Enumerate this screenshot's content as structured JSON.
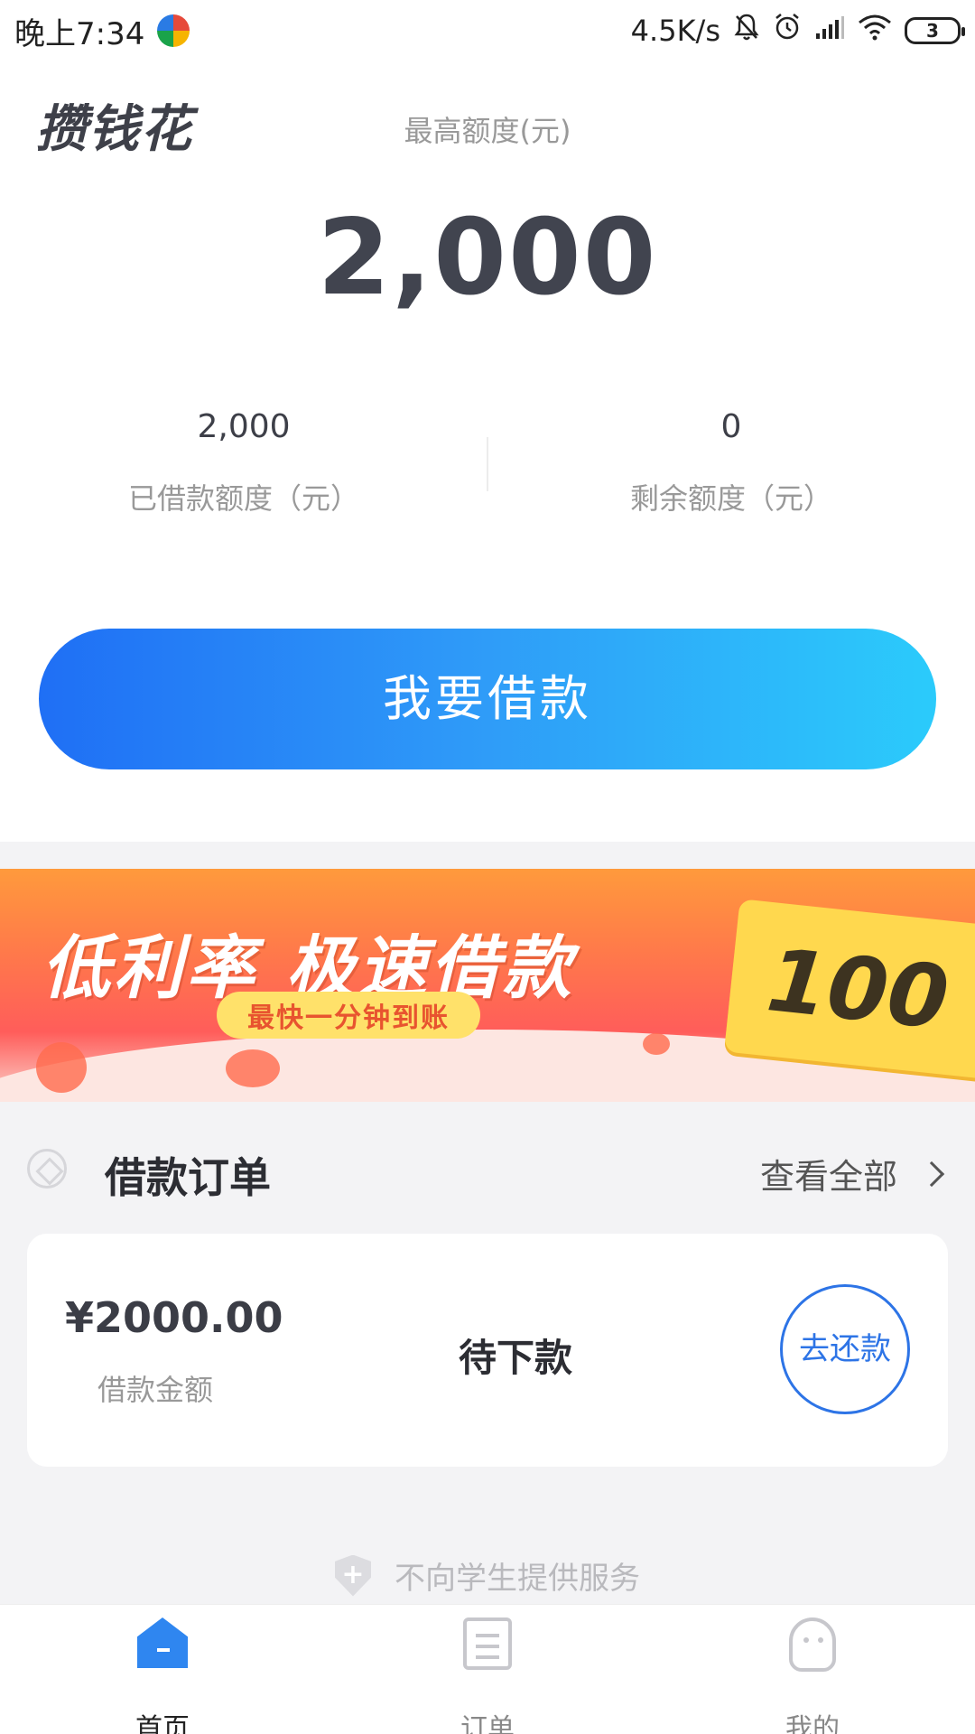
{
  "status_bar": {
    "time": "晚上7:34",
    "net_speed": "4.5K/s",
    "battery": "3"
  },
  "header": {
    "brand": "攒钱花",
    "max_label": "最高额度(元)",
    "max_amount": "2,000"
  },
  "stats": {
    "borrowed_value": "2,000",
    "borrowed_label": "已借款额度（元）",
    "remaining_value": "0",
    "remaining_label": "剩余额度（元）"
  },
  "actions": {
    "borrow_label": "我要借款"
  },
  "banner": {
    "headline": "低利率 极速借款",
    "subline": "最快一分钟到账",
    "ticket_text": "100"
  },
  "orders": {
    "title": "借款订单",
    "view_all": "查看全部",
    "card": {
      "amount": "¥2000.00",
      "amount_label": "借款金额",
      "status": "待下款",
      "repay_label": "去还款"
    }
  },
  "notice": "不向学生提供服务",
  "tabs": [
    {
      "label": "首页",
      "icon": "home-icon",
      "active": true
    },
    {
      "label": "订单",
      "icon": "order-icon",
      "active": false
    },
    {
      "label": "我的",
      "icon": "profile-icon",
      "active": false
    }
  ],
  "colors": {
    "accent_blue": "#2f86f0",
    "button_gradient_start": "#1f6ff5",
    "button_gradient_end": "#2bcbfb",
    "repay_blue": "#2d74e6"
  }
}
